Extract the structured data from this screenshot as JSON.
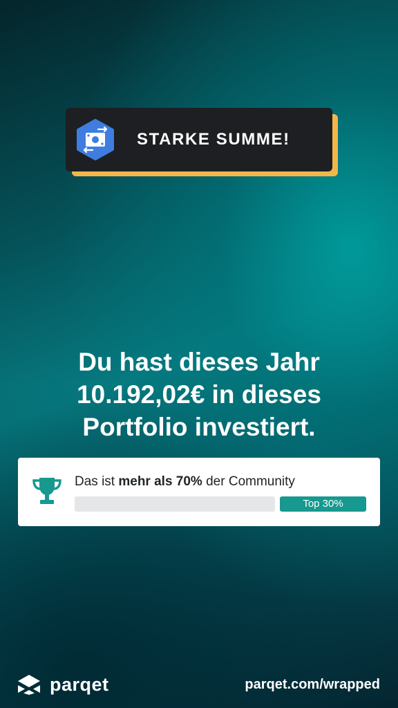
{
  "badge": {
    "title": "STARKE SUMME!",
    "icon": "money-transfer-icon",
    "icon_bg_color": "#3f7de0",
    "accent_color": "#f2b74a"
  },
  "headline": {
    "line1": "Du hast dieses Jahr",
    "line2": "10.192,02€ in dieses",
    "line3": "Portfolio investiert."
  },
  "community_card": {
    "text_prefix": "Das ist ",
    "text_bold": "mehr als 70%",
    "text_suffix": " der Community",
    "bar_label": "Top 30%",
    "bar_color": "#17998f",
    "icon": "trophy-icon"
  },
  "footer": {
    "brand": "parqet",
    "url": "parqet.com/wrapped"
  }
}
